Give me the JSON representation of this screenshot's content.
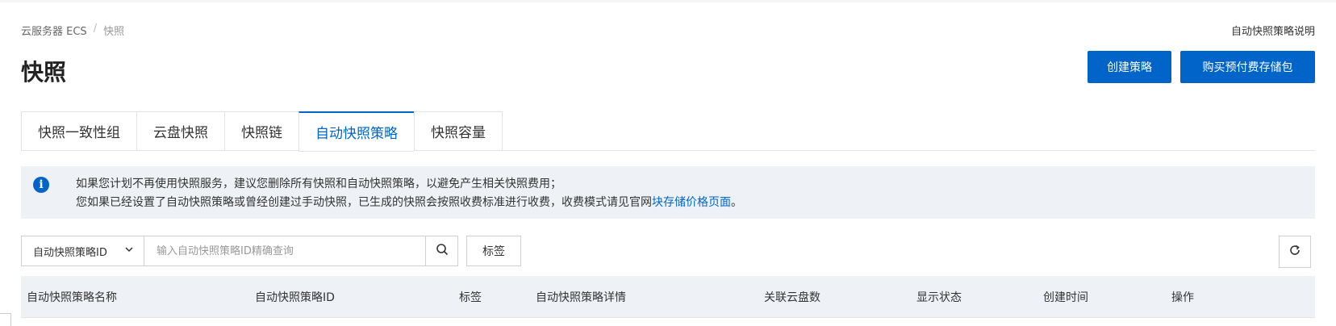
{
  "breadcrumb": {
    "root": "云服务器 ECS",
    "separator": "/",
    "current": "快照"
  },
  "help_link": "自动快照策略说明",
  "page_title": "快照",
  "actions": {
    "create": "创建策略",
    "buy": "购买预付费存储包"
  },
  "tabs": [
    {
      "label": "快照一致性组",
      "active": false
    },
    {
      "label": "云盘快照",
      "active": false
    },
    {
      "label": "快照链",
      "active": false
    },
    {
      "label": "自动快照策略",
      "active": true
    },
    {
      "label": "快照容量",
      "active": false
    }
  ],
  "notice": {
    "icon": "info-icon",
    "line1": "如果您计划不再使用快照服务，建议您删除所有快照和自动快照策略，以避免产生相关快照费用；",
    "line2_prefix": "您如果已经设置了自动快照策略或曾经创建过手动快照，已生成的快照会按照收费标准进行收费，收费模式请见官网",
    "line2_link": "块存储价格页面",
    "line2_suffix": "。"
  },
  "search": {
    "field": "自动快照策略ID",
    "placeholder": "输入自动快照策略ID精确查询",
    "value": ""
  },
  "tag_button": "标签",
  "table": {
    "columns": [
      "自动快照策略名称",
      "自动快照策略ID",
      "标签",
      "自动快照策略详情",
      "关联云盘数",
      "显示状态",
      "创建时间",
      "操作"
    ]
  },
  "colors": {
    "primary": "#0064c8",
    "notice_bg": "#eef2f7"
  }
}
